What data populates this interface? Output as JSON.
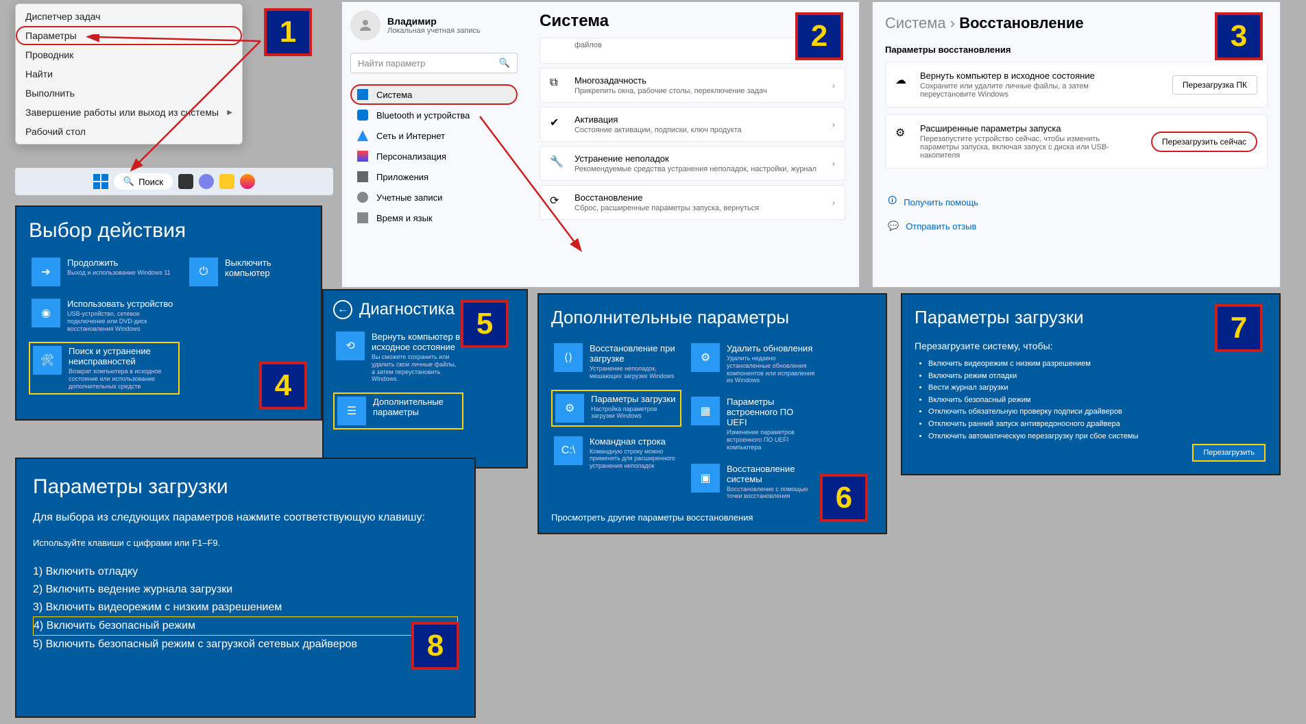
{
  "badges": {
    "1": "1",
    "2": "2",
    "3": "3",
    "4": "4",
    "5": "5",
    "6": "6",
    "7": "7",
    "8": "8"
  },
  "panel1": {
    "menu_items": [
      "Диспетчер задач",
      "Параметры",
      "Проводник",
      "Найти",
      "Выполнить",
      "Завершение работы или выход из системы",
      "Рабочий стол"
    ],
    "search_label": "Поиск"
  },
  "panel2": {
    "user_name": "Владимир",
    "user_sub": "Локальная учетная запись",
    "search_placeholder": "Найти параметр",
    "title": "Система",
    "nav": [
      "Система",
      "Bluetooth и устройства",
      "Сеть и Интернет",
      "Персонализация",
      "Приложения",
      "Учетные записи",
      "Время и язык"
    ],
    "items": [
      {
        "label": "",
        "desc": "файлов"
      },
      {
        "label": "Многозадачность",
        "desc": "Прикрепить окна, рабочие столы, переключение задач"
      },
      {
        "label": "Активация",
        "desc": "Состояние активации, подписки, ключ продукта"
      },
      {
        "label": "Устранение неполадок",
        "desc": "Рекомендуемые средства устранения неполадок, настройки, журнал"
      },
      {
        "label": "Восстановление",
        "desc": "Сброс, расширенные параметры запуска, вернуться"
      }
    ]
  },
  "panel3": {
    "crumb_parent": "Система",
    "crumb_current": "Восстановление",
    "section": "Параметры восстановления",
    "items": [
      {
        "label": "Вернуть компьютер в исходное состояние",
        "desc": "Сохраните или удалите личные файлы, а затем переустановите Windows",
        "btn": "Перезагрузка ПК"
      },
      {
        "label": "Расширенные параметры запуска",
        "desc": "Перезапустите устройство сейчас, чтобы изменить параметры запуска, включая запуск с диска или USB-накопителя",
        "btn": "Перезагрузить сейчас"
      }
    ],
    "help": "Получить помощь",
    "feedback": "Отправить отзыв"
  },
  "panel4": {
    "title": "Выбор действия",
    "tiles": [
      {
        "label": "Продолжить",
        "desc": "Выход и использование Windows 11"
      },
      {
        "label": "Выключить компьютер",
        "desc": ""
      },
      {
        "label": "Использовать устройство",
        "desc": "USB-устройство, сетевое подключение или DVD-диск восстановления Windows"
      },
      {
        "label": "Поиск и устранение неисправностей",
        "desc": "Возврат компьютера в исходное состояние или использование дополнительных средств"
      }
    ]
  },
  "panel5": {
    "title": "Диагностика",
    "tiles": [
      {
        "label": "Вернуть компьютер в исходное состояние",
        "desc": "Вы сможете сохранить или удалить свои личные файлы, а затем переустановить Windows."
      },
      {
        "label": "Дополнительные параметры",
        "desc": ""
      }
    ]
  },
  "panel6": {
    "title": "Дополнительные параметры",
    "tiles": [
      {
        "label": "Восстановление при загрузке",
        "desc": "Устранение неполадок, мешающих загрузке Windows"
      },
      {
        "label": "Удалить обновления",
        "desc": "Удалить недавно установленные обновления компонентов или исправления из Windows"
      },
      {
        "label": "Параметры загрузки",
        "desc": "Настройка параметров загрузки Windows"
      },
      {
        "label": "Параметры встроенного ПО UEFI",
        "desc": "Изменение параметров встроенного ПО UEFI компьютера"
      },
      {
        "label": "Командная строка",
        "desc": "Командную строку можно применять для расширенного устранения неполадок"
      },
      {
        "label": "Восстановление системы",
        "desc": "Восстановление с помощью точки восстановления"
      }
    ],
    "link": "Просмотреть другие параметры восстановления"
  },
  "panel7": {
    "title": "Параметры загрузки",
    "sub": "Перезагрузите систему, чтобы:",
    "list": [
      "Включить видеорежим с низким разрешением",
      "Включить режим отладки",
      "Вести журнал загрузки",
      "Включить безопасный режим",
      "Отключить обязательную проверку подписи драйверов",
      "Отключить ранний запуск антивредоносного драйвера",
      "Отключить автоматическую перезагрузку при сбое системы"
    ],
    "btn": "Перезагрузить"
  },
  "panel8": {
    "title": "Параметры загрузки",
    "sub": "Для выбора из следующих параметров нажмите соответствующую клавишу:",
    "hint": "Используйте клавиши с цифрами или F1–F9.",
    "opts": [
      "1) Включить отладку",
      "2) Включить ведение журнала загрузки",
      "3) Включить видеорежим с низким разрешением",
      "4) Включить безопасный режим",
      "5) Включить безопасный режим с загрузкой сетевых драйверов"
    ]
  }
}
